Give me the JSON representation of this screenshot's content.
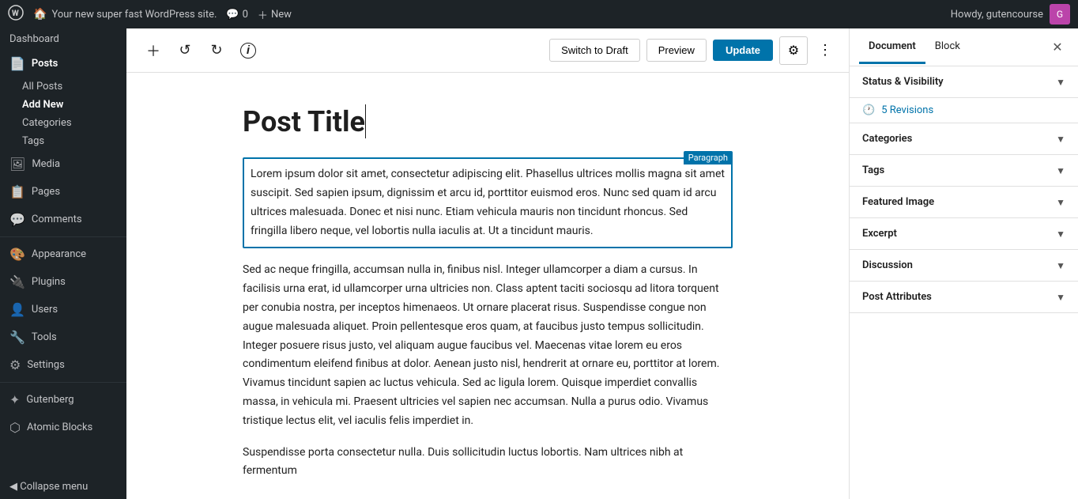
{
  "adminBar": {
    "wpLogoAlt": "WordPress",
    "siteName": "Your new super fast WordPress site.",
    "commentCount": "0",
    "newLabel": "New",
    "howdy": "Howdy, gutencourse",
    "avatarInitial": "G"
  },
  "sidebar": {
    "dashboard": "Dashboard",
    "items": [
      {
        "id": "posts",
        "icon": "📄",
        "label": "Posts",
        "active": true
      },
      {
        "id": "media",
        "icon": "🖼",
        "label": "Media",
        "active": false
      },
      {
        "id": "pages",
        "icon": "📋",
        "label": "Pages",
        "active": false
      },
      {
        "id": "comments",
        "icon": "💬",
        "label": "Comments",
        "active": false
      },
      {
        "id": "appearance",
        "icon": "🎨",
        "label": "Appearance",
        "active": false
      },
      {
        "id": "plugins",
        "icon": "🔌",
        "label": "Plugins",
        "active": false
      },
      {
        "id": "users",
        "icon": "👤",
        "label": "Users",
        "active": false
      },
      {
        "id": "tools",
        "icon": "🔧",
        "label": "Tools",
        "active": false
      },
      {
        "id": "settings",
        "icon": "⚙",
        "label": "Settings",
        "active": false
      },
      {
        "id": "gutenberg",
        "icon": "✦",
        "label": "Gutenberg",
        "active": false
      },
      {
        "id": "atomic-blocks",
        "icon": "⬡",
        "label": "Atomic Blocks",
        "active": false
      }
    ],
    "subItems": [
      {
        "id": "all-posts",
        "label": "All Posts",
        "active": false
      },
      {
        "id": "add-new",
        "label": "Add New",
        "active": true
      },
      {
        "id": "categories",
        "label": "Categories",
        "active": false
      },
      {
        "id": "tags",
        "label": "Tags",
        "active": false
      }
    ],
    "collapseLabel": "Collapse menu"
  },
  "toolbar": {
    "addBlockTitle": "+",
    "undoTitle": "↺",
    "redoTitle": "↻",
    "infoTitle": "ℹ",
    "switchToDraftLabel": "Switch to Draft",
    "previewLabel": "Preview",
    "updateLabel": "Update"
  },
  "editor": {
    "postTitle": "Post Title",
    "paragraphLabel": "Paragraph",
    "paragraph1": "Lorem ipsum dolor sit amet, consectetur adipiscing elit. Phasellus ultrices mollis magna sit amet suscipit. Sed sapien ipsum, dignissim et arcu id, porttitor euismod eros. Nunc sed quam id arcu ultrices malesuada. Donec et nisi nunc. Etiam vehicula mauris non tincidunt rhoncus. Sed fringilla libero neque, vel lobortis nulla iaculis at. Ut a tincidunt mauris.",
    "paragraph2": "Sed ac neque fringilla, accumsan nulla in, finibus nisl. Integer ullamcorper a diam a cursus. In facilisis urna erat, id ullamcorper urna ultricies non. Class aptent taciti sociosqu ad litora torquent per conubia nostra, per inceptos himenaeos. Ut ornare placerat risus. Suspendisse congue non augue malesuada aliquet. Proin pellentesque eros quam, at faucibus justo tempus sollicitudin. Integer posuere risus justo, vel aliquam augue faucibus vel. Maecenas vitae lorem eu eros condimentum eleifend finibus at dolor. Aenean justo nisl, hendrerit at ornare eu, porttitor at lorem. Vivamus tincidunt sapien ac luctus vehicula. Sed ac ligula lorem. Quisque imperdiet convallis massa, in vehicula mi. Praesent ultricies vel sapien nec accumsan. Nulla a purus odio. Vivamus tristique lectus elit, vel iaculis felis imperdiet in.",
    "paragraph3": "Suspendisse porta consectetur nulla. Duis sollicitudin luctus lobortis. Nam ultrices nibh at fermentum"
  },
  "rightPanel": {
    "tabs": [
      {
        "id": "document",
        "label": "Document",
        "active": true
      },
      {
        "id": "block",
        "label": "Block",
        "active": false
      }
    ],
    "sections": [
      {
        "id": "status-visibility",
        "label": "Status & Visibility",
        "open": true
      },
      {
        "id": "revisions",
        "label": "Revisions",
        "open": true,
        "count": "5 Revisions"
      },
      {
        "id": "categories",
        "label": "Categories",
        "open": false
      },
      {
        "id": "tags",
        "label": "Tags",
        "open": false
      },
      {
        "id": "featured-image",
        "label": "Featured Image",
        "open": false
      },
      {
        "id": "excerpt",
        "label": "Excerpt",
        "open": false
      },
      {
        "id": "discussion",
        "label": "Discussion",
        "open": false
      },
      {
        "id": "post-attributes",
        "label": "Post Attributes",
        "open": false
      }
    ]
  }
}
